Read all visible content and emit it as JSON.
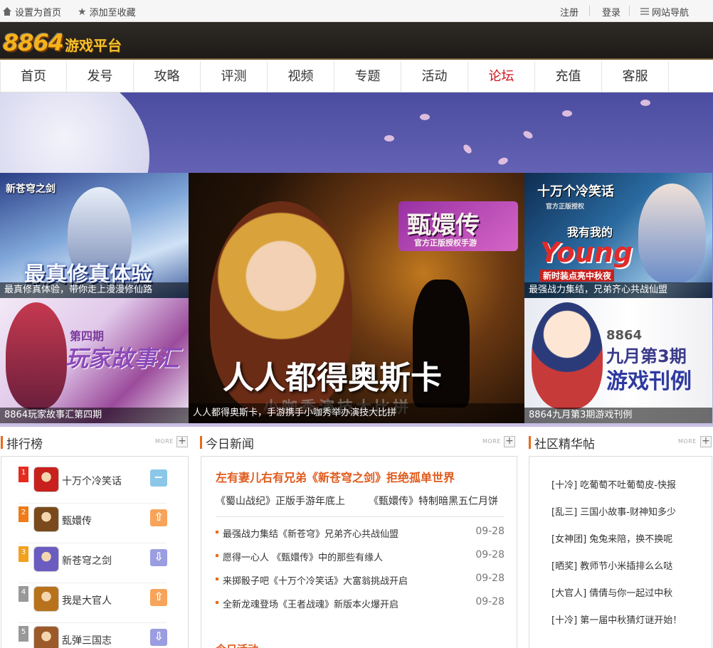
{
  "topbar": {
    "set_home": "设置为首页",
    "add_fav": "添加至收藏",
    "register": "注册",
    "login": "登录",
    "site_nav": "网站导航"
  },
  "logo": {
    "number": "8864",
    "text": "游戏平台"
  },
  "nav": {
    "items": [
      "首页",
      "发号",
      "攻略",
      "评测",
      "视频",
      "专题",
      "活动",
      "论坛",
      "充值",
      "客服"
    ],
    "active": "论坛"
  },
  "banner": {
    "tiles": [
      {
        "caption": "最真修真体验，带你走上漫漫修仙路",
        "art_title": "最真修真体验",
        "art_logo": "新苍穹之剑"
      },
      {
        "caption": "8864玩家故事汇第四期",
        "art_title": "玩家故事汇",
        "art_sub": "第四期"
      },
      {
        "caption": "人人都得奥斯卡，手游携手小咖秀举办演技大比拼",
        "art_title": "人人都得奥斯卡",
        "art_logo": "甄嬛传",
        "art_logo_sub": "官方正版授权手游",
        "art_sub": "小咖秀演技大比拼"
      },
      {
        "caption": "最强战力集结，兄弟齐心共战仙盟",
        "art_title": "我有我的",
        "art_word": "Young",
        "art_logo": "十万个冷笑话",
        "art_logo_sub": "官方正版授权",
        "art_sub": "新时装点亮中秋夜"
      },
      {
        "caption": "8864九月第3期游戏刊例",
        "art_num": "8864",
        "art_line1": "九月第3期",
        "art_line2": "游戏刊例"
      }
    ]
  },
  "more_label": "MORE",
  "ranking": {
    "title": "排行榜",
    "items": [
      {
        "rank": "1",
        "name": "十万个冷笑话",
        "trend": "−",
        "trend_color": "#8cc7e8",
        "badge_color": "#e62b1f",
        "icon_color": "#c8201c"
      },
      {
        "rank": "2",
        "name": "甄嬛传",
        "trend": "⇧",
        "trend_color": "#f7a45a",
        "badge_color": "#f07b18",
        "icon_color": "#7a4a1c"
      },
      {
        "rank": "3",
        "name": "新苍穹之剑",
        "trend": "⇩",
        "trend_color": "#9a9de0",
        "badge_color": "#f2a11e",
        "icon_color": "#6a5cc0"
      },
      {
        "rank": "4",
        "name": "我是大官人",
        "trend": "⇧",
        "trend_color": "#f7a45a",
        "badge_color": "#999999",
        "icon_color": "#b8721c"
      },
      {
        "rank": "5",
        "name": "乱弹三国志",
        "trend": "⇩",
        "trend_color": "#9a9de0",
        "badge_color": "#999999",
        "icon_color": "#9c5a2a"
      }
    ]
  },
  "news": {
    "title": "今日新闻",
    "headline": "左有妻儿右有兄弟《新苍穹之剑》拒绝孤单世界",
    "sub1": "《蜀山战纪》正版手游年底上",
    "sub2": "《甄嬛传》特制暗黑五仁月饼",
    "items": [
      {
        "text": "最强战力集结《新苍穹》兄弟齐心共战仙盟",
        "date": "09-28"
      },
      {
        "text": "愿得一心人 《甄嬛传》中的那些有缘人",
        "date": "09-28"
      },
      {
        "text": "来掷骰子吧《十万个冷笑话》大富翁挑战开启",
        "date": "09-28"
      },
      {
        "text": "全新龙魂登场《王者战魂》新版本火爆开启",
        "date": "09-28"
      }
    ],
    "today_activity": "今日活动"
  },
  "forum": {
    "title": "社区精华帖",
    "items": [
      "[十冷] 吃葡萄不吐葡萄皮-快报",
      "[乱三] 三国小故事-财神知多少",
      "[女神团] 兔兔来陪，换不换呢",
      "[晒奖] 教师节小米插排么么哒",
      "[大官人] 倩倩与你一起过中秋",
      "[十冷] 第一届中秋猜灯谜开始！"
    ]
  },
  "colors": {
    "accent": "#e86a1a",
    "nav_active": "#d0121b"
  }
}
